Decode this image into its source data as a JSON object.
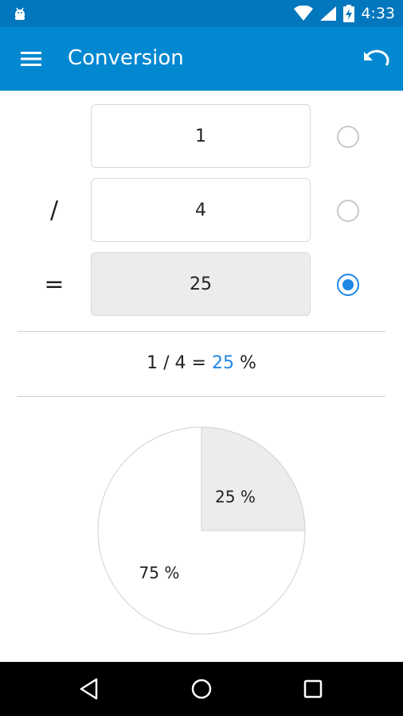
{
  "status_bar": {
    "time": "4:33",
    "icons": [
      "android-debug-icon",
      "wifi-icon",
      "signal-icon",
      "battery-charging-icon"
    ]
  },
  "app_bar": {
    "title": "Conversion",
    "menu_icon": "menu-icon",
    "undo_icon": "undo-icon",
    "color": "#0288d1"
  },
  "form": {
    "rows": [
      {
        "operator": "",
        "value": "1",
        "selected": false
      },
      {
        "operator": "/",
        "value": "4",
        "selected": false
      },
      {
        "operator": "=",
        "value": "25",
        "selected": true
      }
    ]
  },
  "summary": {
    "prefix": "1 / 4 = ",
    "result": "25",
    "suffix": " %"
  },
  "chart_data": {
    "type": "pie",
    "values": [
      25,
      75
    ],
    "labels": [
      "25 %",
      "75 %"
    ],
    "colors": [
      "#ececec",
      "#ffffff"
    ]
  },
  "nav_bar": {
    "icons": [
      "back-icon",
      "home-icon",
      "recents-icon"
    ]
  },
  "accent_color": "#1e88e5"
}
